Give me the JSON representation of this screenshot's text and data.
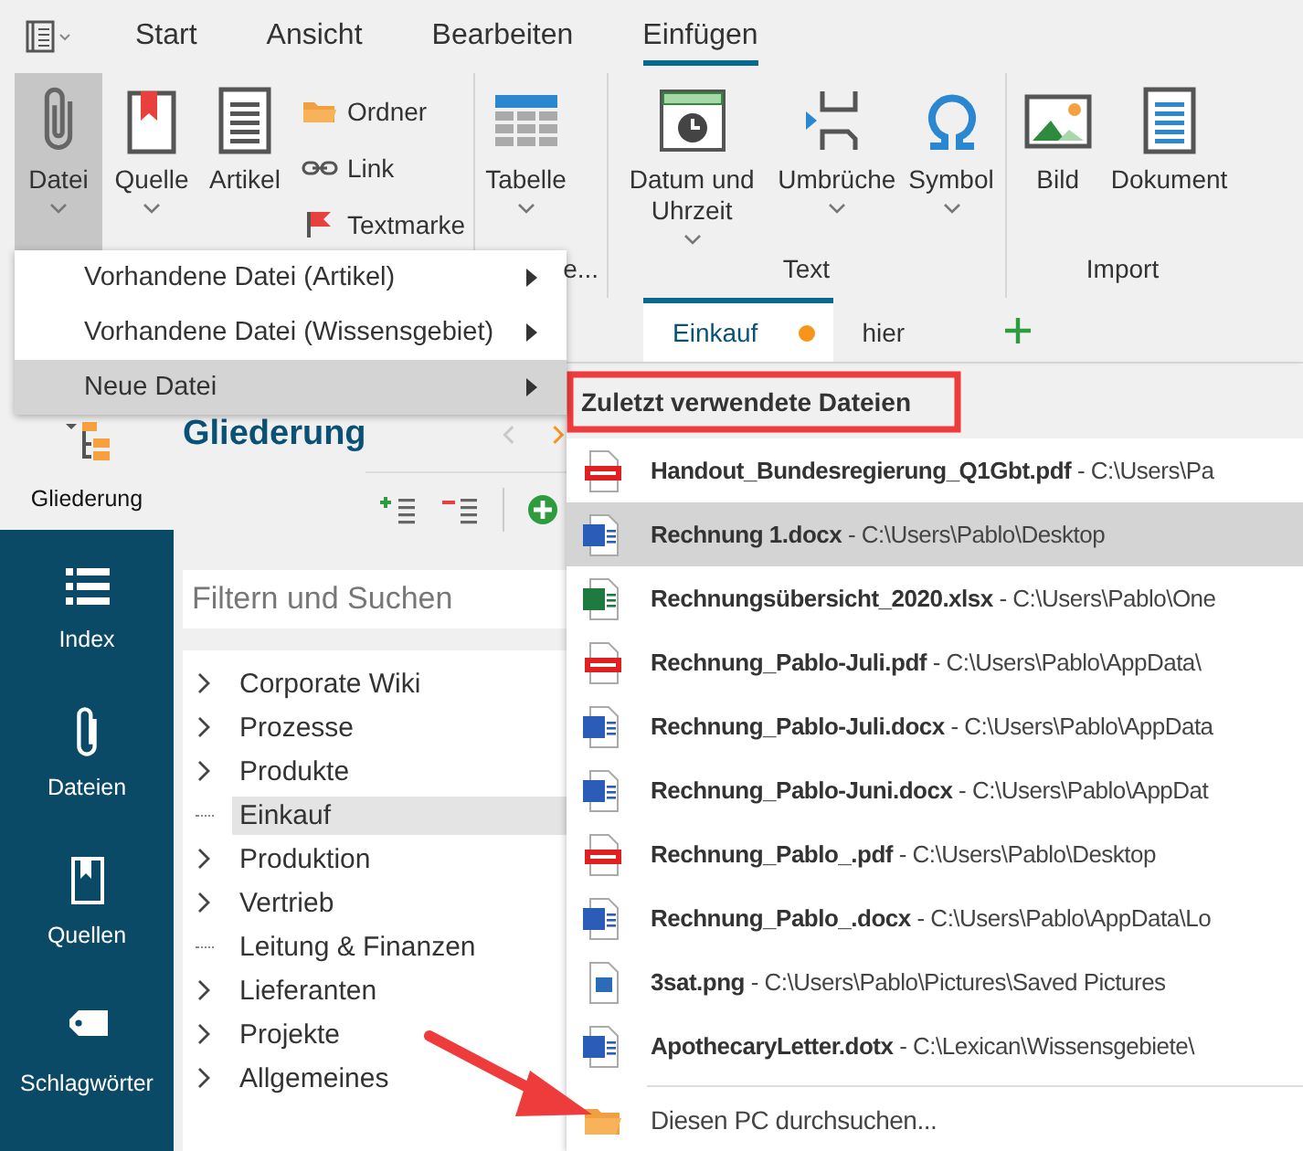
{
  "ribbon_tabs": [
    {
      "label": "Start",
      "selected": false
    },
    {
      "label": "Ansicht",
      "selected": false
    },
    {
      "label": "Bearbeiten",
      "selected": false
    },
    {
      "label": "Einfügen",
      "selected": true
    }
  ],
  "ribbon_groups": [
    {
      "buttons": [
        {
          "label": "Datei",
          "kind": "large",
          "dropdown": true,
          "pressed": true
        },
        {
          "label": "Quelle",
          "kind": "large",
          "dropdown": true,
          "pressed": false
        },
        {
          "label": "Artikel",
          "kind": "large",
          "dropdown": false,
          "pressed": false
        },
        {
          "label": "Ordner",
          "kind": "small",
          "dropdown": false,
          "pressed": false
        },
        {
          "label": "Link",
          "kind": "small",
          "dropdown": false,
          "pressed": false
        },
        {
          "label": "Textmarke",
          "kind": "small",
          "dropdown": false,
          "pressed": false
        }
      ]
    },
    {
      "label": "e...",
      "buttons": [
        {
          "label": "Tabelle",
          "kind": "large",
          "dropdown": true,
          "pressed": false
        }
      ]
    },
    {
      "label": "Text",
      "buttons": [
        {
          "label": "Datum und Uhrzeit",
          "kind": "large",
          "dropdown": true,
          "pressed": false
        },
        {
          "label": "Umbrüche",
          "kind": "large",
          "dropdown": true,
          "pressed": false
        },
        {
          "label": "Symbol",
          "kind": "large",
          "dropdown": true,
          "pressed": false
        }
      ]
    },
    {
      "label": "Import",
      "buttons": [
        {
          "label": "Bild",
          "kind": "large",
          "dropdown": false,
          "pressed": false
        },
        {
          "label": "Dokument",
          "kind": "large",
          "dropdown": false,
          "pressed": false
        }
      ]
    }
  ],
  "sidebar": {
    "items": [
      {
        "label": "Gliederung",
        "selected": true
      },
      {
        "label": "Index",
        "selected": false
      },
      {
        "label": "Dateien",
        "selected": false
      },
      {
        "label": "Quellen",
        "selected": false
      },
      {
        "label": "Schlagwörter",
        "selected": false
      }
    ]
  },
  "panel": {
    "title": "Gliederung",
    "back_disabled": true,
    "forward_disabled": false,
    "filter": {
      "placeholder": "Filtern und Suchen"
    },
    "tree": [
      {
        "label": "Corporate Wiki",
        "expandable": true,
        "selected": false
      },
      {
        "label": "Prozesse",
        "expandable": true,
        "selected": false
      },
      {
        "label": "Produkte",
        "expandable": true,
        "selected": false
      },
      {
        "label": "Einkauf",
        "expandable": false,
        "selected": true
      },
      {
        "label": "Produktion",
        "expandable": true,
        "selected": false
      },
      {
        "label": "Vertrieb",
        "expandable": true,
        "selected": false
      },
      {
        "label": "Leitung & Finanzen",
        "expandable": false,
        "selected": false
      },
      {
        "label": "Lieferanten",
        "expandable": true,
        "selected": false
      },
      {
        "label": "Projekte",
        "expandable": true,
        "selected": false
      },
      {
        "label": "Allgemeines",
        "expandable": true,
        "selected": false
      }
    ]
  },
  "doc_tabs": [
    {
      "label": "Einkauf",
      "selected": true,
      "modified": true
    },
    {
      "label": "hier",
      "selected": false,
      "modified": false
    }
  ],
  "menu": {
    "items": [
      {
        "label": "Vorhandene Datei (Artikel)",
        "selected": false
      },
      {
        "label": "Vorhandene Datei (Wissensgebiet)",
        "selected": false
      },
      {
        "label": "Neue Datei",
        "selected": true
      }
    ]
  },
  "submenu": {
    "header": "Zuletzt verwendete Dateien",
    "files": [
      {
        "name": "Handout_Bundesregierung_Q1Gbt.pdf",
        "path": "- C:\\Users\\Pa",
        "kind": "pdf",
        "selected": false
      },
      {
        "name": "Rechnung 1.docx",
        "path": "- C:\\Users\\Pablo\\Desktop",
        "kind": "word",
        "selected": true
      },
      {
        "name": "Rechnungsübersicht_2020.xlsx",
        "path": "- C:\\Users\\Pablo\\One",
        "kind": "excel",
        "selected": false
      },
      {
        "name": "Rechnung_Pablo-Juli.pdf",
        "path": "- C:\\Users\\Pablo\\AppData\\",
        "kind": "pdf",
        "selected": false
      },
      {
        "name": "Rechnung_Pablo-Juli.docx",
        "path": "- C:\\Users\\Pablo\\AppData",
        "kind": "word",
        "selected": false
      },
      {
        "name": "Rechnung_Pablo-Juni.docx",
        "path": "- C:\\Users\\Pablo\\AppDat",
        "kind": "word",
        "selected": false
      },
      {
        "name": "Rechnung_Pablo_.pdf",
        "path": "- C:\\Users\\Pablo\\Desktop",
        "kind": "pdf",
        "selected": false
      },
      {
        "name": "Rechnung_Pablo_.docx",
        "path": "- C:\\Users\\Pablo\\AppData\\Lo",
        "kind": "word",
        "selected": false
      },
      {
        "name": "3sat.png",
        "path": "- C:\\Users\\Pablo\\Pictures\\Saved Pictures",
        "kind": "image",
        "selected": false
      },
      {
        "name": "ApothecaryLetter.dotx",
        "path": "- C:\\Lexican\\Wissensgebiete\\",
        "kind": "word",
        "selected": false
      }
    ],
    "browse": "Diesen PC durchsuchen..."
  }
}
